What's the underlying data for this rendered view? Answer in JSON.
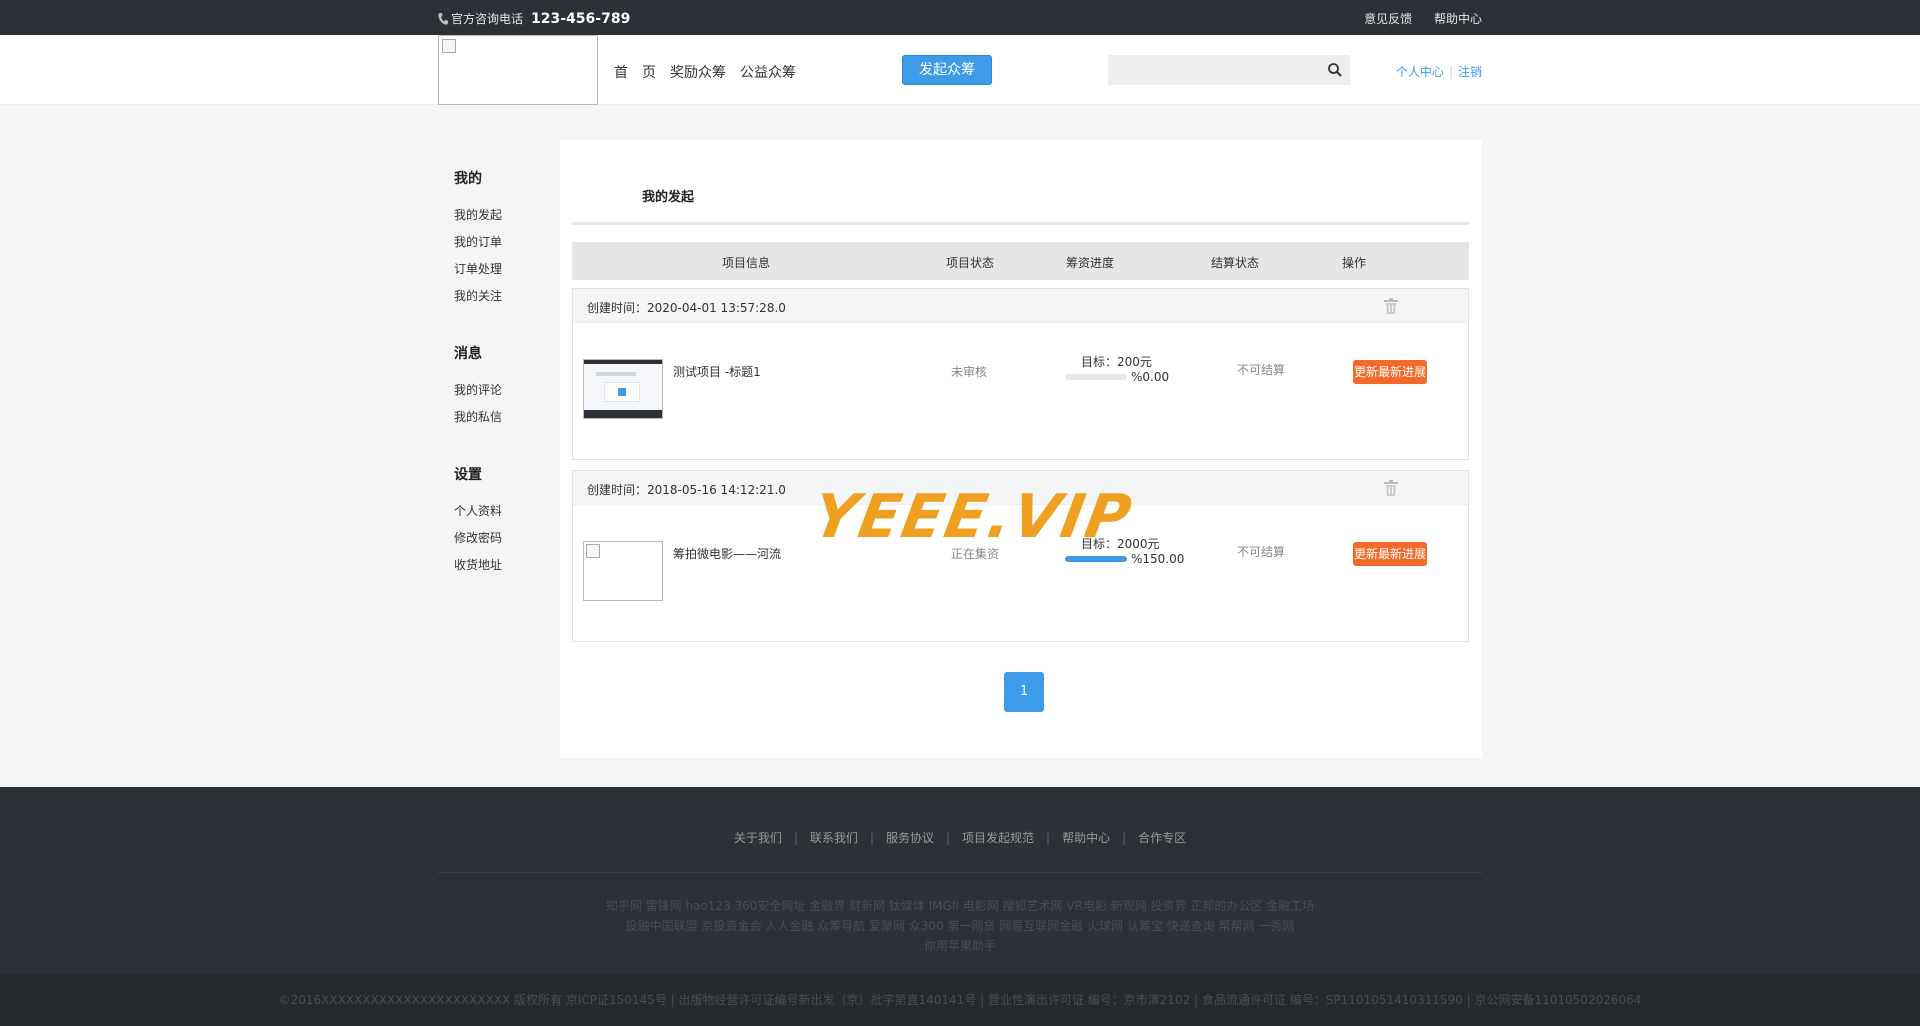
{
  "topbar": {
    "hotline_label": "官方咨询电话",
    "hotline_number": "123-456-789",
    "feedback": "意见反馈",
    "help": "帮助中心"
  },
  "header": {
    "nav": [
      "首　页",
      "奖励众筹",
      "公益众筹"
    ],
    "launch_button": "发起众筹",
    "search_placeholder": "",
    "personal_center": "个人中心",
    "logout": "注销"
  },
  "sidebar": {
    "groups": [
      {
        "title": "我的",
        "items": [
          "我的发起",
          "我的订单",
          "订单处理",
          "我的关注"
        ]
      },
      {
        "title": "消息",
        "items": [
          "我的评论",
          "我的私信"
        ]
      },
      {
        "title": "设置",
        "items": [
          "个人资料",
          "修改密码",
          "收货地址"
        ]
      }
    ]
  },
  "content": {
    "title": "我的发起",
    "columns": [
      "项目信息",
      "项目状态",
      "筹资进度",
      "结算状态",
      "操作"
    ],
    "orders": [
      {
        "created": "创建时间：2020-04-01 13:57:28.0",
        "name": "测试项目 -标题1",
        "status": "未审核",
        "target": "目标：200元",
        "percent_text": "%0.00",
        "progress": 0,
        "settle": "不可结算",
        "action": "更新最新进展"
      },
      {
        "created": "创建时间：2018-05-16 14:12:21.0",
        "name": "筹拍微电影——河流",
        "status": "正在集资",
        "target": "目标：2000元",
        "percent_text": "%150.00",
        "progress": 1,
        "settle": "不可结算",
        "action": "更新最新进展"
      }
    ],
    "page": "1"
  },
  "watermark": "YEEE.VIP",
  "footer": {
    "links": [
      "关于我们",
      "联系我们",
      "服务协议",
      "项目发起规范",
      "帮助中心",
      "合作专区"
    ],
    "friends_line1": "知乎网 雷锋网 hao123 360安全网址 金融界 财新网 钛媒体 IMGII 电影网 搜狐艺术网 VR电影 新观网 投资界 正邦的办公区 金融工场",
    "friends_line2": "投融中国联盟 京投资金会 人人金融 众筹导航 爱聚网 众300 第一网贷 网易互联网金融 火球网 认筹宝 快递查询 帮帮网 一秀网",
    "friends_line3": "你用苹果助手",
    "copyright": "©2016XXXXXXXXXXXXXXXXXXXXXXX 版权所有 京ICP证150145号 | 出版物经营许可证编号新出发（京）批字第直140141号 | 营业性演出许可证 编号：京市演2102 | 食品流通许可证 编号：SP1101051410311590 | 京公网安备11010502026064"
  },
  "colors": {
    "accent": "#3d9be9",
    "action": "#f26a2b",
    "dark": "#2d3036"
  }
}
